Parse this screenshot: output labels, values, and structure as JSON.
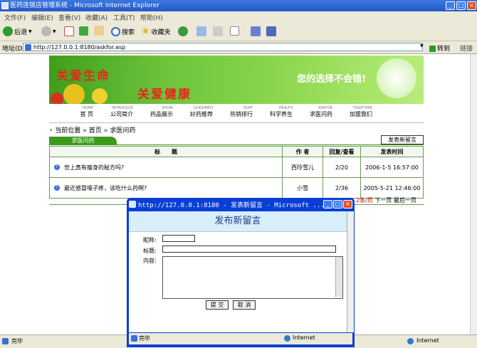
{
  "window": {
    "title": "医药连锁店管理系统 - Microsoft Internet Explorer"
  },
  "menu": [
    "文件(F)",
    "编辑(E)",
    "查看(V)",
    "收藏(A)",
    "工具(T)",
    "帮助(H)"
  ],
  "toolbar": {
    "back": "后退",
    "search": "搜索",
    "favorites": "收藏夹"
  },
  "address": {
    "label": "地址(D)",
    "url": "http://127.0.0.1:8180/askfor.asp",
    "go": "转到",
    "links": "链接"
  },
  "banner": {
    "slogan1": "关爱生命",
    "slogan2": "关爱健康",
    "slogan3": "您的选择不会错!"
  },
  "nav": [
    {
      "en": "HOME",
      "cn": "首 页"
    },
    {
      "en": "INTRODUCE",
      "cn": "公司简介"
    },
    {
      "en": "SHOW",
      "cn": "药品展示"
    },
    {
      "en": "GOODMED",
      "cn": "好药推荐"
    },
    {
      "en": "SORT",
      "cn": "热销排行"
    },
    {
      "en": "HEALTH",
      "cn": "科学养生"
    },
    {
      "en": "ASKFOR",
      "cn": "求医问药"
    },
    {
      "en": "TOGETHER",
      "cn": "加盟我们"
    }
  ],
  "breadcrumb": {
    "label": "当前位置",
    "home": "首页",
    "current": "求医问药"
  },
  "section": {
    "tab": "求医问药",
    "post_button": "发表新留言"
  },
  "table": {
    "headers": [
      "标　　题",
      "作 者",
      "回复/查看",
      "发表时间"
    ],
    "rows": [
      {
        "subject": "世上真有瘦身的秘方吗?",
        "author": "西玲雪儿",
        "stats": "2/20",
        "time": "2006-1-5 16:57:00"
      },
      {
        "subject": "最近感冒嗓子疼，该吃什么药啊?",
        "author": "小雪",
        "stats": "2/36",
        "time": "2005-5-21 12:46:00"
      }
    ]
  },
  "pager": {
    "count": "2条/页",
    "next": "下一页",
    "last": "最后一页"
  },
  "status": {
    "left": "完毕",
    "zone": "Internet"
  },
  "popup": {
    "title": "http://127.0.0.1:8180 - 发表新留言 - Microsoft ...",
    "heading": "发布新留言",
    "nick_label": "昵称:",
    "title_label": "标题:",
    "content_label": "内容:",
    "submit": "提 交",
    "cancel": "取 消",
    "status": "完毕",
    "zone": "Internet"
  }
}
